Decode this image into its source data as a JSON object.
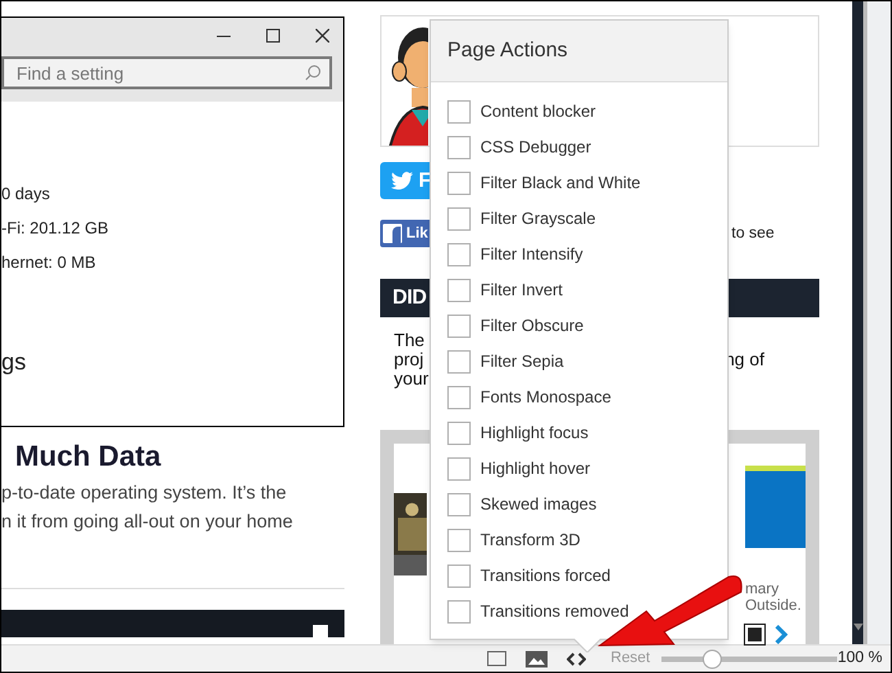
{
  "settings_window": {
    "search": {
      "placeholder": "Find a setting"
    },
    "lines": [
      "0 days",
      "-Fi: 201.12 GB",
      "hernet: 0 MB"
    ],
    "section_heading": "gs"
  },
  "article": {
    "heading": "Much Data",
    "lines": [
      "p-to-date operating system. It’s the",
      "n it from going all-out on your home"
    ]
  },
  "sidebar": {
    "twitter_button": "F",
    "facebook_button": "Lik",
    "facebook_note": "to see",
    "banner": "DID",
    "blurb_left": [
      "The",
      "proj",
      "your"
    ],
    "blurb_right": "ng of",
    "ad_lines": [
      "mary",
      "Outside."
    ]
  },
  "page_actions": {
    "title": "Page Actions",
    "items": [
      {
        "label": "Content blocker",
        "checked": false
      },
      {
        "label": "CSS Debugger",
        "checked": false
      },
      {
        "label": "Filter Black and White",
        "checked": false
      },
      {
        "label": "Filter Grayscale",
        "checked": false
      },
      {
        "label": "Filter Intensify",
        "checked": false
      },
      {
        "label": "Filter Invert",
        "checked": false
      },
      {
        "label": "Filter Obscure",
        "checked": false
      },
      {
        "label": "Filter Sepia",
        "checked": false
      },
      {
        "label": "Fonts Monospace",
        "checked": false
      },
      {
        "label": "Highlight focus",
        "checked": false
      },
      {
        "label": "Highlight hover",
        "checked": false
      },
      {
        "label": "Skewed images",
        "checked": false
      },
      {
        "label": "Transform 3D",
        "checked": false
      },
      {
        "label": "Transitions forced",
        "checked": false
      },
      {
        "label": "Transitions removed",
        "checked": false
      }
    ]
  },
  "status_bar": {
    "reset": "Reset",
    "zoom": {
      "level": 0.29
    },
    "zoom_reading": "100 %"
  }
}
